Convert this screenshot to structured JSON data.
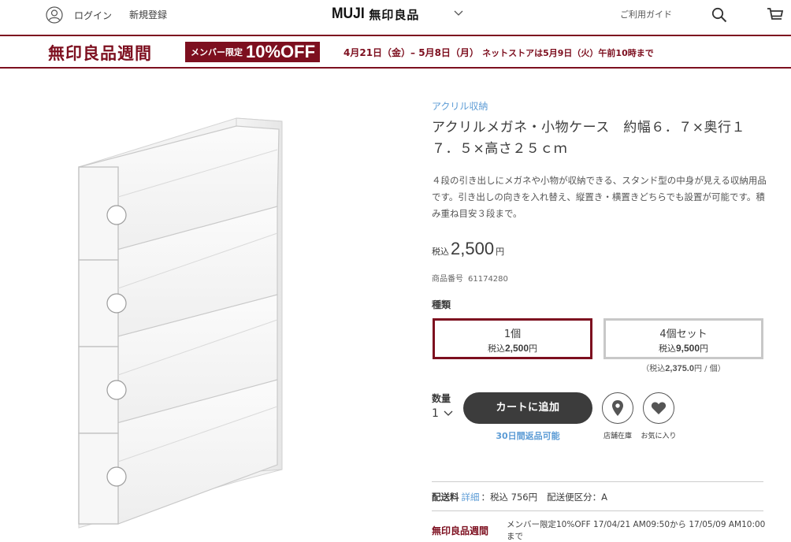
{
  "header": {
    "login_label": "ログイン",
    "register_label": "新規登録",
    "logo_latin": "MUJI",
    "logo_jp": "無印良品",
    "guide_label": "ご利用ガイド",
    "icons": [
      "user-icon",
      "chevron-down-icon",
      "search-icon",
      "cart-icon"
    ]
  },
  "banner": {
    "title": "無印良品週間",
    "badge_label": "メンバー限定",
    "badge_discount": "10%OFF",
    "dates": "4月21日（金）– 5月8日（月）",
    "note": "ネットストアは5月9日（火）午前10時まで"
  },
  "product": {
    "category": "アクリル収納",
    "title": "アクリルメガネ・小物ケース　約幅６．７×奥行１７．５×高さ２５ｃｍ",
    "description": "４段の引き出しにメガネや小物が収納できる、スタンド型の中身が見える収納用品です。引き出しの向きを入れ替え、縦置き・横置きどちらでも設置が可能です。積み重ね目安３段まで。",
    "price_prefix": "税込",
    "price": "2,500",
    "price_suffix": "円",
    "code_label": "商品番号",
    "code": "61174280",
    "kind_label": "種類",
    "options": [
      {
        "name": "1個",
        "tax_label": "税込",
        "price": "2,500",
        "yen": "円"
      },
      {
        "name": "4個セット",
        "tax_label": "税込",
        "price": "9,500",
        "yen": "円"
      }
    ],
    "unit_prefix": "（税込",
    "unit_price": "2,375.0",
    "unit_suffix": "円 / 個）",
    "qty_label": "数量",
    "qty_value": "1",
    "cart_button": "カートに追加",
    "return_note": "30日間返品可能",
    "store_stock_label": "店舗在庫",
    "favorite_label": "お気に入り",
    "shipping_label": "配送料",
    "shipping_detail": "詳細",
    "shipping_value": "：税込 756円",
    "shipping_class": "配送便区分：A",
    "promo_title": "無印良品週間",
    "promo_text": "メンバー限定10%OFF 17/04/21 AM09:50から 17/05/09 AM10:00まで"
  },
  "colors": {
    "brand": "#7d0f1f",
    "link": "#5b9bd5",
    "button": "#3c3c3c"
  }
}
